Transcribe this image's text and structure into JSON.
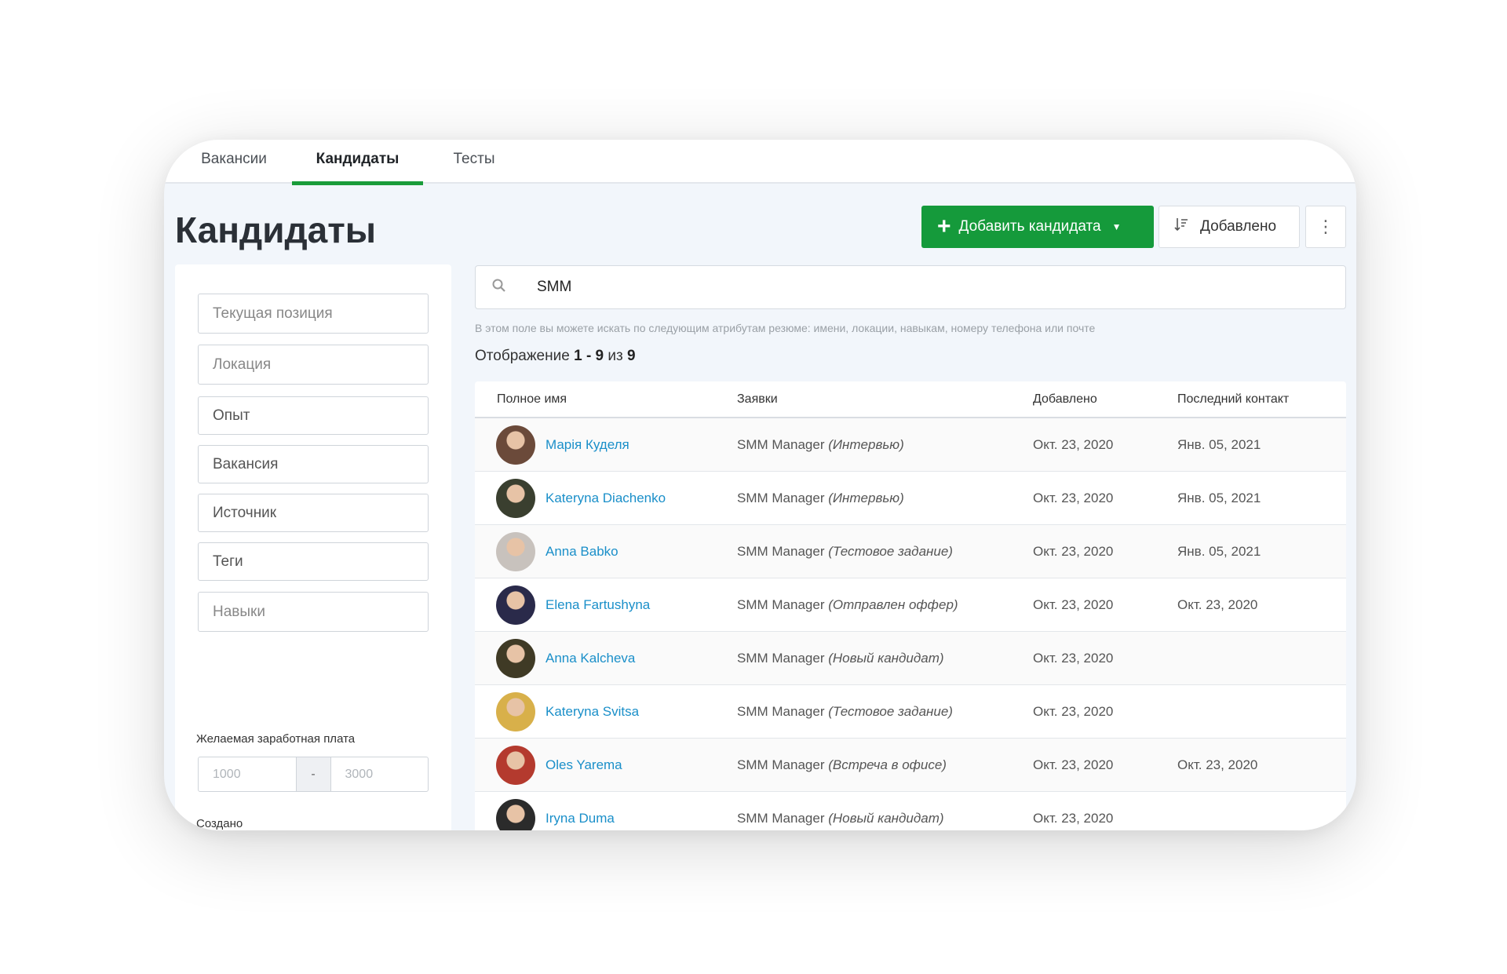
{
  "tabs": [
    {
      "label": "Вакансии"
    },
    {
      "label": "Кандидаты"
    },
    {
      "label": "Тесты"
    }
  ],
  "page_title": "Кандидаты",
  "toolbar": {
    "add_label": "Добавить кандидата",
    "sort_label": "Добавлено"
  },
  "filters": {
    "position_placeholder": "Текущая позиция",
    "location_placeholder": "Локация",
    "experience_label": "Опыт",
    "vacancy_label": "Вакансия",
    "source_label": "Источник",
    "tags_label": "Теги",
    "skills_placeholder": "Навыки",
    "salary_label": "Желаемая заработная плата",
    "salary_from": "1000",
    "salary_dash": "-",
    "salary_to": "3000",
    "created_label": "Создано"
  },
  "search": {
    "value": "SMM",
    "hint": "В этом поле вы можете искать по следующим атрибутам резюме: имени, локации, навыкам, номеру телефона или почте"
  },
  "showing": {
    "prefix": "Отображение",
    "range": "1 - 9",
    "of": "из",
    "total": "9"
  },
  "table": {
    "headers": {
      "name": "Полное имя",
      "applications": "Заявки",
      "added": "Добавлено",
      "last_contact": "Последний контакт"
    },
    "rows": [
      {
        "name": "Марія Куделя",
        "vacancy": "SMM Manager",
        "status": "(Интервью)",
        "added": "Окт. 23, 2020",
        "last_contact": "Янв. 05, 2021",
        "avatar_color": "#6b4a3a"
      },
      {
        "name": "Kateryna Diachenko",
        "vacancy": "SMM Manager",
        "status": "(Интервью)",
        "added": "Окт. 23, 2020",
        "last_contact": "Янв. 05, 2021",
        "avatar_color": "#3a3f2f"
      },
      {
        "name": "Anna Babko",
        "vacancy": "SMM Manager",
        "status": "(Тестовое задание)",
        "added": "Окт. 23, 2020",
        "last_contact": "Янв. 05, 2021",
        "avatar_color": "#c8c2bd"
      },
      {
        "name": "Elena Fartushyna",
        "vacancy": "SMM Manager",
        "status": "(Отправлен оффер)",
        "added": "Окт. 23, 2020",
        "last_contact": "Окт. 23, 2020",
        "avatar_color": "#2a2a4a"
      },
      {
        "name": "Anna Kalcheva",
        "vacancy": "SMM Manager",
        "status": "(Новый кандидат)",
        "added": "Окт. 23, 2020",
        "last_contact": "",
        "avatar_color": "#3f3a25"
      },
      {
        "name": "Kateryna Svitsa",
        "vacancy": "SMM Manager",
        "status": "(Тестовое задание)",
        "added": "Окт. 23, 2020",
        "last_contact": "",
        "avatar_color": "#d8b04a"
      },
      {
        "name": "Oles Yarema",
        "vacancy": "SMM Manager",
        "status": "(Встреча в офисе)",
        "added": "Окт. 23, 2020",
        "last_contact": "Окт. 23, 2020",
        "avatar_color": "#b43a2e"
      },
      {
        "name": "Iryna Duma",
        "vacancy": "SMM Manager",
        "status": "(Новый кандидат)",
        "added": "Окт. 23, 2020",
        "last_contact": "",
        "avatar_color": "#2b2b2b"
      }
    ]
  },
  "icons": {
    "plus": "plus-icon",
    "caret": "caret-down-icon",
    "sort": "sort-icon",
    "more": "more-vertical-icon",
    "search": "search-icon"
  },
  "colors": {
    "accent": "#159a3b",
    "link": "#1a8fc9"
  }
}
